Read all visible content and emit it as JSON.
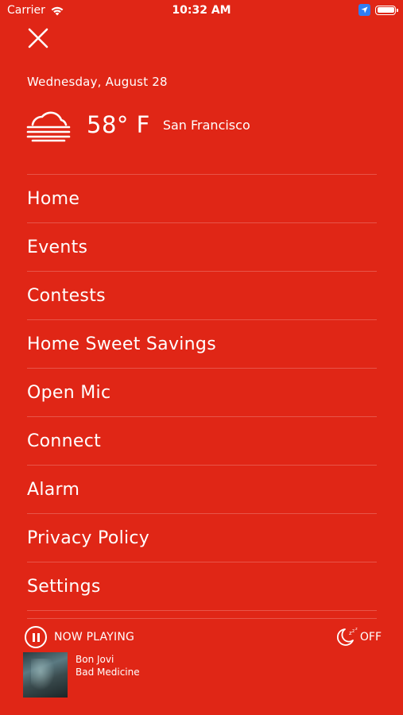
{
  "status_bar": {
    "carrier": "Carrier",
    "time": "10:32 AM"
  },
  "header": {
    "date": "Wednesday, August 28",
    "weather": {
      "icon": "fog-cloud-icon",
      "temperature": "58° F",
      "city": "San Francisco"
    }
  },
  "menu": {
    "items": [
      {
        "label": "Home"
      },
      {
        "label": "Events"
      },
      {
        "label": "Contests"
      },
      {
        "label": "Home Sweet Savings"
      },
      {
        "label": "Open Mic"
      },
      {
        "label": "Connect"
      },
      {
        "label": "Alarm"
      },
      {
        "label": "Privacy Policy"
      },
      {
        "label": "Settings"
      }
    ]
  },
  "player": {
    "now_playing_label": "NOW PLAYING",
    "sleep_timer_label": "OFF",
    "artist": "Bon Jovi",
    "song": "Bad Medicine"
  },
  "colors": {
    "background": "#e02616",
    "text": "#ffffff",
    "location_badge": "#2f7df6"
  }
}
